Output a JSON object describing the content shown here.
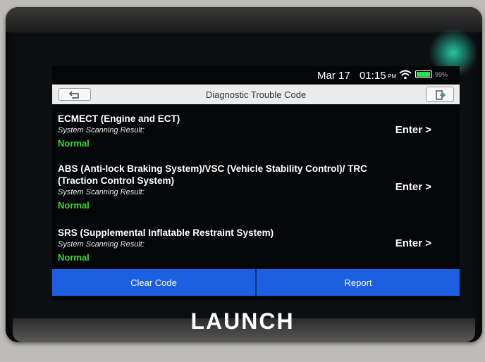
{
  "status_bar": {
    "date": "Mar 17",
    "time": "01:15",
    "ampm": "PM",
    "battery_percent_label": "99%",
    "battery_level": 0.99,
    "wifi_icon": "wifi-icon",
    "battery_icon": "battery-icon"
  },
  "title_bar": {
    "title": "Diagnostic Trouble Code",
    "back_icon": "back-arrow-icon",
    "exit_icon": "exit-icon"
  },
  "systems": [
    {
      "name": "ECMECT (Engine and ECT)",
      "result_label": "System Scanning Result:",
      "status": "Normal",
      "enter_label": "Enter >"
    },
    {
      "name": "ABS (Anti-lock Braking System)/VSC (Vehicle Stability Control)/ TRC (Traction Control System)",
      "result_label": "System Scanning Result:",
      "status": "Normal",
      "enter_label": "Enter >"
    },
    {
      "name": "SRS (Supplemental Inflatable Restraint System)",
      "result_label": "System Scanning Result:",
      "status": "Normal",
      "enter_label": "Enter >"
    }
  ],
  "actions": {
    "clear_code": "Clear Code",
    "report": "Report"
  },
  "brand": "LAUNCH",
  "colors": {
    "status_normal": "#30dd2e",
    "action_blue": "#1c5fe0",
    "title_bar_bg": "#ececec",
    "screen_bg": "#050608"
  }
}
